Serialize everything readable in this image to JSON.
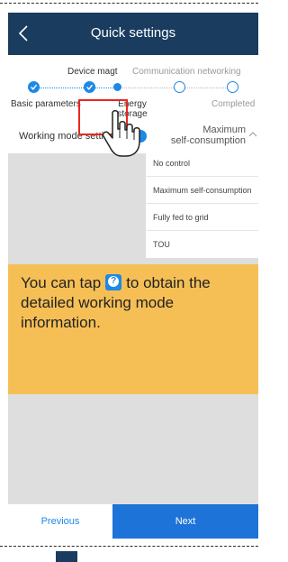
{
  "header": {
    "title": "Quick settings",
    "back_icon": "chevron-left-icon"
  },
  "steps": [
    {
      "label": "Basic parameters",
      "state": "done",
      "row": "bottom"
    },
    {
      "label": "Device magt",
      "state": "done",
      "row": "top"
    },
    {
      "label": "Energy storage\ncontrol",
      "state": "current",
      "row": "bottom"
    },
    {
      "label": "Communication networking",
      "state": "todo",
      "row": "top"
    },
    {
      "label": "Completed",
      "state": "todo",
      "row": "bottom"
    }
  ],
  "working_mode": {
    "label": "Working mode setti",
    "value": "Maximum\nself-consumption",
    "options": [
      "No control",
      "Maximum self-consumption",
      "Fully fed to grid",
      "TOU"
    ]
  },
  "note": {
    "text_before": "You can tap",
    "text_after": "to obtain the detailed working mode information.",
    "icon": "help-icon"
  },
  "footer": {
    "previous_label": "Previous",
    "next_label": "Next"
  },
  "colors": {
    "header": "#1a3d5f",
    "accent": "#1e88e5",
    "next_button": "#1e73d8",
    "note": "#f6bf55",
    "highlight": "#e8271f"
  }
}
